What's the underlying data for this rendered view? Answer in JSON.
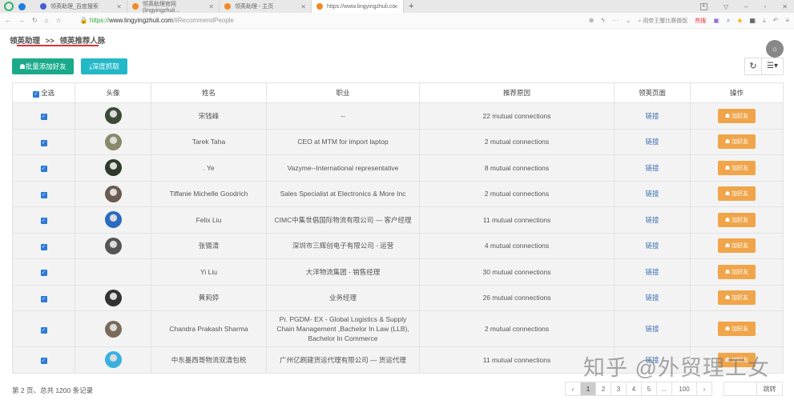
{
  "browser": {
    "tabs": [
      {
        "label": "领英助理_百度搜索",
        "color": "#4a5bd6"
      },
      {
        "label": "领英助理官网 (lingyingzhuli...",
        "color": "#f08a24"
      },
      {
        "label": "领英助理 - 主页",
        "color": "#f08a24"
      },
      {
        "label": "https://www.lingyingzhuli.co",
        "color": "#f08a24"
      }
    ],
    "new_tab": "+",
    "tab_count": "4",
    "url_scheme": "https://",
    "url_host": "www.lingyingzhuli.com",
    "url_path": "/liRecommendPeople",
    "search_placeholder": "用帝王蟹比赛做饭",
    "hot_label": "热搜"
  },
  "breadcrumb": {
    "root": "领英助理",
    "sep": ">>",
    "current": "领英推荐人脉"
  },
  "toolbar": {
    "batch_add": "批量添加好友",
    "deep_crawl": "深度抓取"
  },
  "table": {
    "headers": {
      "select_all": "全选",
      "avatar": "头像",
      "name": "姓名",
      "job": "职业",
      "reason": "推荐原因",
      "page": "领英页面",
      "action": "操作"
    },
    "link_label": "链接",
    "add_label": "加好友",
    "rows": [
      {
        "name": "宋钱峰",
        "job": "--",
        "reason": "22 mutual connections",
        "avatar": "#3d4a3a"
      },
      {
        "name": "Tarek Taha",
        "job": "CEO at MTM for import laptop",
        "reason": "2 mutual connections",
        "avatar": "#8a8a6a"
      },
      {
        "name": ". Ye",
        "job": "Vazyme--International representative",
        "reason": "8 mutual connections",
        "avatar": "#2d3a2a"
      },
      {
        "name": "Tiffanie Michelle Goodrich",
        "job": "Sales Specialist at Electronics & More Inc",
        "reason": "2 mutual connections",
        "avatar": "#6a5a50"
      },
      {
        "name": "Felix Liu",
        "job": "CIMC中集世倡国际物流有限公司 — 客户经理",
        "reason": "11 mutual connections",
        "avatar": "#2a6ac0"
      },
      {
        "name": "张锡清",
        "job": "深圳市三辉创电子有限公司 - 运营",
        "reason": "4 mutual connections",
        "avatar": "#555"
      },
      {
        "name": "Yi Liu",
        "job": "大洋物流集团 - 销售经理",
        "reason": "30 mutual connections",
        "avatar": ""
      },
      {
        "name": "黄莉婷",
        "job": "业务经理",
        "reason": "26 mutual connections",
        "avatar": "#333"
      },
      {
        "name": "Chandra Prakash Sharma",
        "job": "Pr. PGDM- EX - Global Logistics & Supply Chain Management ,Bachelor In Law (LLB), Bachelor In Commerce",
        "reason": "2 mutual connections",
        "avatar": "#7a6a5a"
      },
      {
        "name": "中东墨西哥物流双清包税",
        "job": "广州亿刷建货运代理有限公司 — 货运代理",
        "reason": "11 mutual connections",
        "avatar": "#3ab0e0"
      }
    ]
  },
  "footer": {
    "summary": "第 2 页、总共 1200 条记录",
    "pages": [
      "‹",
      "1",
      "2",
      "3",
      "4",
      "5",
      "...",
      "100",
      "›"
    ],
    "active_page": "1",
    "jump": "跳转"
  },
  "watermark": "知乎 @外贸理工女"
}
